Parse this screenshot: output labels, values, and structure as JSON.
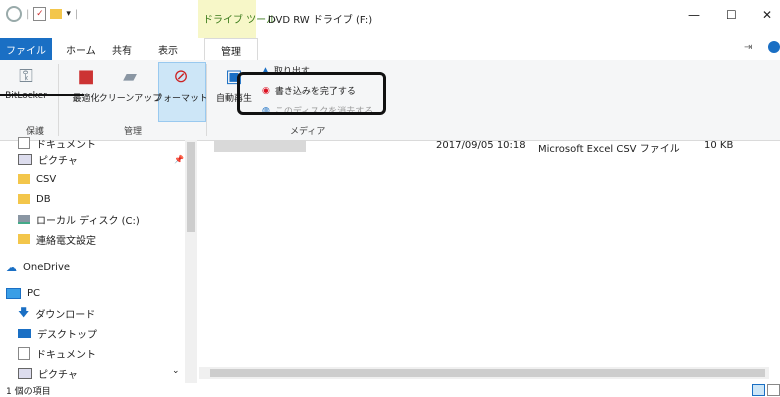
{
  "titlebar": {
    "context_tab": "ドライブ ツール",
    "title": "DVD RW ドライブ (F:)",
    "controls": {
      "minimize": "—",
      "maximize": "☐",
      "close": "✕"
    }
  },
  "tabs": {
    "file": "ファイル",
    "home": "ホーム",
    "share": "共有",
    "view": "表示",
    "manage": "管理"
  },
  "ribbon": {
    "bitlocker": "BitLocker",
    "optimize": "最適化",
    "cleanup": "クリーンアップ",
    "format": "フォーマット",
    "autoplay": "自動再生",
    "eject": "取り出す",
    "finish_burn": "書き込みを完了する",
    "erase_disc": "このディスクを消去する",
    "groups": {
      "protect": "保護",
      "manage": "管理",
      "media": "メディア"
    }
  },
  "nav": {
    "items": [
      {
        "label": "ドキュメント",
        "icon": "documents-icon"
      },
      {
        "label": "ピクチャ",
        "icon": "pictures-icon"
      },
      {
        "label": "CSV",
        "icon": "folder-icon"
      },
      {
        "label": "DB",
        "icon": "folder-icon"
      },
      {
        "label": "ローカル ディスク (C:)",
        "icon": "drive-icon"
      },
      {
        "label": "連絡電文設定",
        "icon": "folder-icon"
      },
      {
        "label": "OneDrive",
        "icon": "onedrive-icon"
      },
      {
        "label": "PC",
        "icon": "pc-icon"
      },
      {
        "label": "ダウンロード",
        "icon": "download-icon"
      },
      {
        "label": "デスクトップ",
        "icon": "desktop-icon"
      },
      {
        "label": "ドキュメント",
        "icon": "documents-icon"
      },
      {
        "label": "ピクチャ",
        "icon": "pictures-icon"
      }
    ]
  },
  "files": [
    {
      "date": "2017/09/05 10:18",
      "type": "Microsoft Excel CSV ファイル",
      "size": "10 KB"
    }
  ],
  "status": {
    "count": "1 個の項目"
  },
  "colors": {
    "file_tab": "#1a6fc4",
    "context_tab": "#f7f7c8",
    "selected": "#cde6f7"
  }
}
